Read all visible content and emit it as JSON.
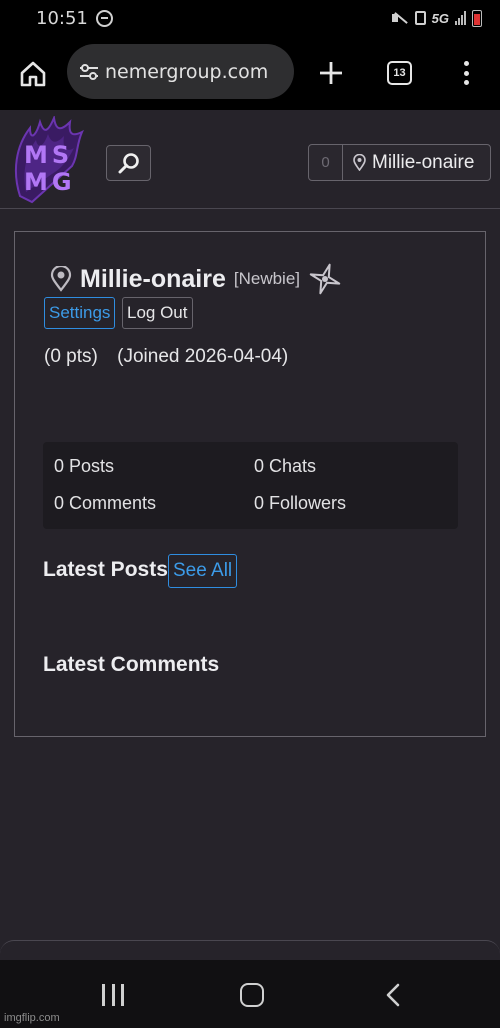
{
  "status_bar": {
    "time": "10:51",
    "network": "5G"
  },
  "browser": {
    "url": "nemergroup.com",
    "tab_count": "13"
  },
  "header": {
    "logo_line1": "MS",
    "logo_line2": "MG",
    "notification_count": "0",
    "username": "Millie-onaire"
  },
  "profile": {
    "username": "Millie-onaire",
    "rank": "[Newbie]",
    "settings_label": "Settings",
    "logout_label": "Log Out",
    "points": "(0 pts)",
    "joined": "(Joined 2026-04-04)",
    "stats": {
      "posts": "0 Posts",
      "chats": "0 Chats",
      "comments": "0 Comments",
      "followers": "0 Followers"
    },
    "latest_posts_title": "Latest Posts",
    "see_all_label": "See All",
    "latest_comments_title": "Latest Comments"
  },
  "colors": {
    "background": "#26232a",
    "accent_link": "#3c9be8",
    "logo_purple": "#b277f5"
  },
  "watermark": "imgflip.com"
}
